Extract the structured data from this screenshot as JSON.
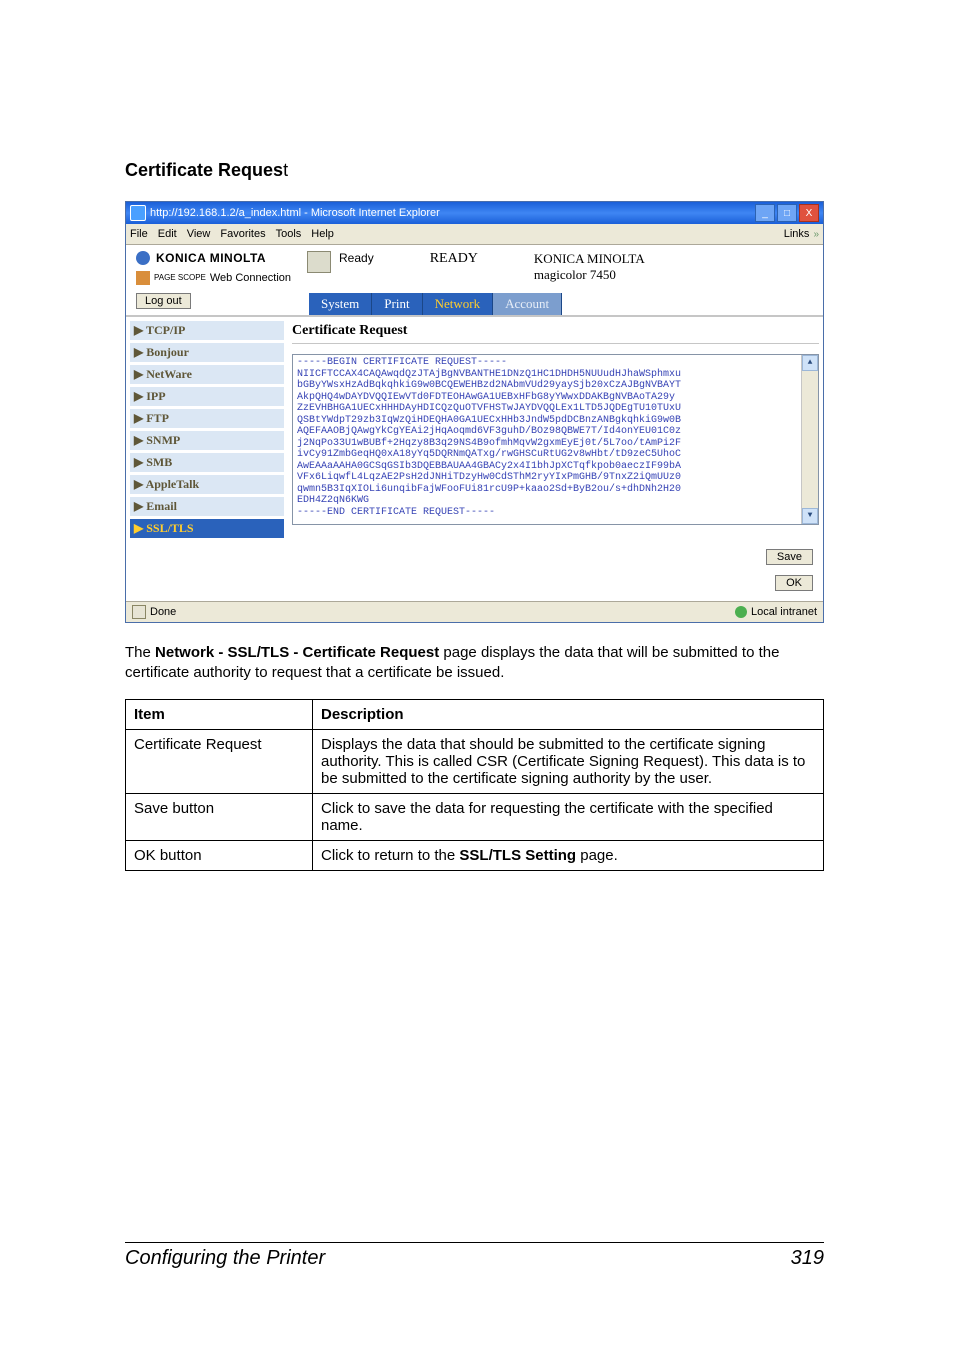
{
  "section": {
    "title": "Certificate Reques",
    "title_suffix": "t"
  },
  "ie": {
    "title": "http://192.168.1.2/a_index.html - Microsoft Internet Explorer",
    "win_btns": {
      "min": "_",
      "max": "□",
      "close": "X"
    },
    "menus": [
      "File",
      "Edit",
      "View",
      "Favorites",
      "Tools",
      "Help"
    ],
    "links_label": "Links",
    "links_chev": "»"
  },
  "header": {
    "brand": "KONICA MINOLTA",
    "pagescope_prefix": "PAGE SCOPE",
    "pagescope": "Web Connection",
    "ready_small": "Ready",
    "ready_big": "READY",
    "device_name": "KONICA MINOLTA",
    "device_model": "magicolor 7450",
    "logout": "Log out",
    "tabs": {
      "system": "System",
      "print": "Print",
      "network": "Network",
      "account": "Account"
    }
  },
  "side_nav": [
    {
      "label": "▶ TCP/IP",
      "key": "tcpip"
    },
    {
      "label": "▶ Bonjour",
      "key": "bonjour"
    },
    {
      "label": "▶ NetWare",
      "key": "netware"
    },
    {
      "label": "▶ IPP",
      "key": "ipp"
    },
    {
      "label": "▶ FTP",
      "key": "ftp"
    },
    {
      "label": "▶ SNMP",
      "key": "snmp"
    },
    {
      "label": "▶ SMB",
      "key": "smb"
    },
    {
      "label": "▶ AppleTalk",
      "key": "appletalk"
    },
    {
      "label": "▶ Email",
      "key": "email"
    },
    {
      "label": "▶ SSL/TLS",
      "key": "ssltls"
    }
  ],
  "panel": {
    "title": "Certificate Request",
    "cert_body": "-----BEGIN CERTIFICATE REQUEST-----\nNIICFTCCAX4CAQAwqdQzJTAjBgNVBANTHE1DNzQ1HC1DHDH5NUUudHJhaWSphmxu\nbGByYWsxHzAdBqkqhkiG9w0BCQEWEHBzd2NAbmVUd29yaySjb20xCzAJBgNVBAYT\nAkpQHQ4wDAYDVQQIEwVTd0FDTEOHAwGA1UEBxHFbG8yYWwxDDAKBgNVBAoTA29y\nZzEVHBHGA1UECxHHHDAyHDICQzQuOTVFHSTwJAYDVQQLEx1LTD5JQDEgTU10TUxU\nQSBtYWdpT29zb3IqWzQiHDEQHA0GA1UECxHHb3JndW5pdDCBnzANBgkqhkiG9w0B\nAQEFAAOBjQAwgYkCgYEAi2jHqAoqmd6VF3guhD/BOz98QBWE7T/Id4onYEU01C0z\nj2NqPo33U1wBUBf+2Hqzy8B3q29NS4B9ofmhMqvW2gxmEyEj0t/5L7oo/tAmPi2F\nivCy91ZmbGeqHQ0xA18yYq5DQRNmQATxg/rwGHSCuRtUG2v8wHbt/tD9zeC5UhoC\nAwEAAaAAHA0GCSqGSIb3DQEBBAUAA4GBACy2x4I1bhJpXCTqfkpob0aeczIF99bA\nVFx6LiqwfL4LqzAE2PsH2dJNHiTDzyHw0CdSThM2ryYIxPmGHB/9TnxZ2iQmUUz0\nqwmn5B3IqXIOLi6unqibFajWFooFUi81rcU9P+kaao2Sd+ByB2ou/s+dhDNh2H20\nEDH4Z2qN6KWG\n-----END CERTIFICATE REQUEST-----",
    "save": "Save",
    "ok": "OK"
  },
  "statusbar": {
    "done": "Done",
    "zone": "Local intranet"
  },
  "body_text": {
    "pre": "The ",
    "bold": "Network - SSL/TLS - Certificate Request",
    "post": " page displays the data that will be submitted to the certificate authority to request that a certificate be issued."
  },
  "table": {
    "col_item": "Item",
    "col_desc": "Description",
    "rows": [
      {
        "item": "Certificate Request",
        "desc": "Displays the data that should be submitted to the certificate signing authority. This is called CSR (Certificate Signing Request). This data is to be submitted to the certificate signing authority by the user."
      },
      {
        "item": "Save button",
        "desc": "Click to save the data for requesting the certificate with the specified name."
      },
      {
        "item": "OK button",
        "desc_pre": "Click to return to the ",
        "desc_bold": "SSL/TLS Setting",
        "desc_post": " page."
      }
    ]
  },
  "footer": {
    "left": "Configuring the Printer",
    "right": "319"
  }
}
